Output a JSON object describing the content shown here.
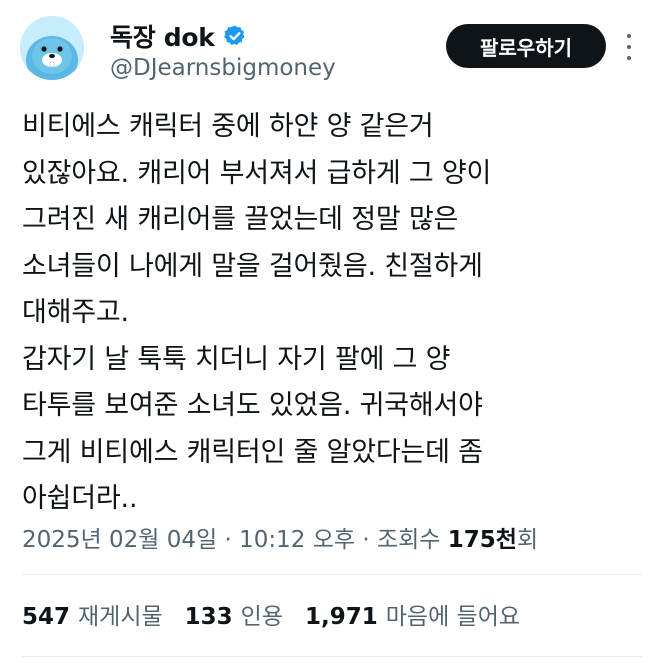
{
  "header": {
    "display_name": "독장 dok",
    "handle": "@DJearnsbigmoney",
    "follow_label": "팔로우하기"
  },
  "body": {
    "lines": [
      "비티에스 캐릭터 중에 하얀 양 같은거",
      "있잖아요. 캐리어 부서져서 급하게 그 양이",
      "그려진 새 캐리어를 끌었는데 정말 많은",
      "소녀들이 나에게 말을 걸어줬음. 친절하게",
      "대해주고.",
      "갑자기 날 툭툭 치더니 자기 팔에 그 양",
      "타투를 보여준 소녀도 있었음. 귀국해서야",
      "그게 비티에스 캐릭터인 줄 알았다는데 좀",
      "아쉽더라.."
    ]
  },
  "meta": {
    "date": "2025년 02월 04일",
    "time": "10:12 오후",
    "views_label": "조회수",
    "views_count": "175천",
    "views_unit": "회",
    "separator": "·"
  },
  "stats": {
    "reposts_count": "547",
    "reposts_label": "재게시물",
    "quotes_count": "133",
    "quotes_label": "인용",
    "likes_count": "1,971",
    "likes_label": "마음에 들어요"
  },
  "colors": {
    "text_primary": "#0f1419",
    "text_secondary": "#536471",
    "verified_blue": "#1d9bf0",
    "avatar_bg": "#c7ecfb",
    "follow_bg": "#0f1419"
  },
  "icons": {
    "verified": "verified-badge-icon",
    "more": "more-options-icon"
  }
}
